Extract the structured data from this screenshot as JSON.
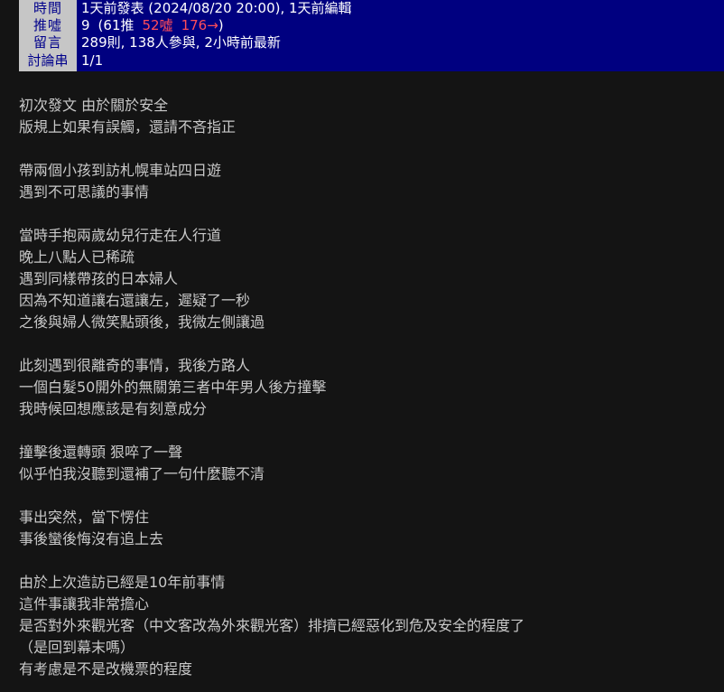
{
  "meta": {
    "rows": [
      {
        "label": "時間",
        "label_name": "meta-label-time",
        "value_name": "meta-value-time"
      },
      {
        "label": "推噓",
        "label_name": "meta-label-rating",
        "value_name": "meta-value-rating"
      },
      {
        "label": "留言",
        "label_name": "meta-label-comments",
        "value_name": "meta-value-comments"
      },
      {
        "label": "討論串",
        "label_name": "meta-label-thread",
        "value_name": "meta-value-thread"
      }
    ],
    "time_value": "1天前發表 (2024/08/20 20:00), 1天前編輯",
    "rating": {
      "score": "9",
      "open_paren": "(",
      "push": "61推",
      "boo": "52噓",
      "arrow": "176→",
      "close_paren": ")"
    },
    "comments_value": "289則, 138人參與, 2小時前最新",
    "thread_value": "1/1",
    "colors": {
      "header_bg": "#000080",
      "label_bg": "#c6c6c6",
      "label_fg": "#00008b",
      "value_fg": "#ffffff",
      "boo_fg": "#ff4d5a",
      "body_bg": "#141414",
      "body_fg": "#c9c9c9"
    }
  },
  "post": {
    "lines": [
      "初次發文 由於關於安全",
      "版規上如果有誤觸，還請不吝指正",
      "",
      "帶兩個小孩到訪札幌車站四日遊",
      "遇到不可思議的事情",
      "",
      "當時手抱兩歲幼兒行走在人行道",
      "晚上八點人已稀疏",
      "遇到同樣帶孩的日本婦人",
      "因為不知道讓右還讓左，遲疑了一秒",
      "之後與婦人微笑點頭後，我微左側讓過",
      "",
      "此刻遇到很離奇的事情，我後方路人",
      "一個白髮50開外的無關第三者中年男人後方撞擊",
      "我時候回想應該是有刻意成分",
      "",
      "撞擊後還轉頭 狠啐了一聲",
      "似乎怕我沒聽到還補了一句什麼聽不清",
      "",
      "事出突然，當下愣住",
      "事後蠻後悔沒有追上去",
      "",
      "由於上次造訪已經是10年前事情",
      "這件事讓我非常擔心",
      "是否對外來觀光客（中文客改為外來觀光客）排擠已經惡化到危及安全的程度了",
      "（是回到幕末嗎）",
      "有考慮是不是改機票的程度"
    ]
  }
}
